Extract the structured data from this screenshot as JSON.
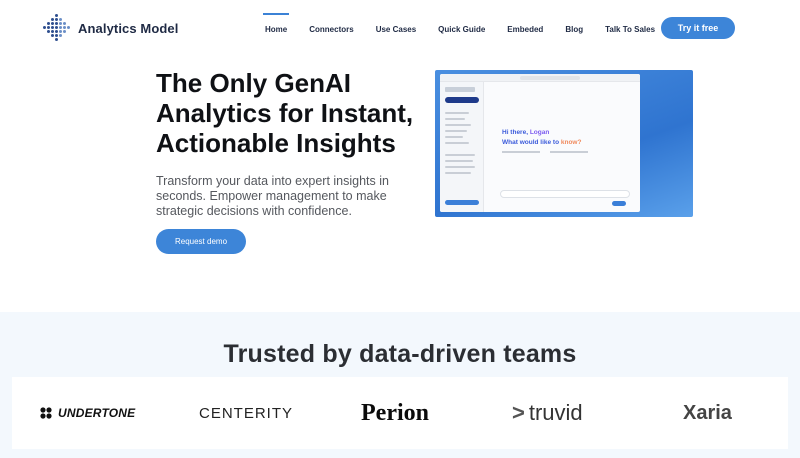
{
  "header": {
    "logo_text": "Analytics Model",
    "nav": [
      {
        "label": "Home",
        "active": true
      },
      {
        "label": "Connectors"
      },
      {
        "label": "Use Cases"
      },
      {
        "label": "Quick Guide"
      },
      {
        "label": "Embeded"
      },
      {
        "label": "Blog"
      },
      {
        "label": "Talk To Sales"
      }
    ],
    "cta_label": "Try it free"
  },
  "hero": {
    "title_line1": "The Only GenAI",
    "title_line2": "Analytics for Instant,",
    "title_line3": "Actionable Insights",
    "subtitle": "Transform your data into expert insights in seconds. Empower management to make strategic decisions with confidence.",
    "cta_label": "Request demo"
  },
  "preview": {
    "greeting_prefix": "Hi there, ",
    "greeting_name": "Logan",
    "question_prefix": "What would like to ",
    "question_highlight": "know?"
  },
  "trusted": {
    "title": "Trusted by data-driven teams",
    "logos": [
      "UNDERTONE",
      "CENTERITY",
      "Perion",
      "truvid",
      "Xaria"
    ]
  },
  "colors": {
    "accent": "#3d85d8",
    "trusted_bg": "#f3f8fd"
  }
}
